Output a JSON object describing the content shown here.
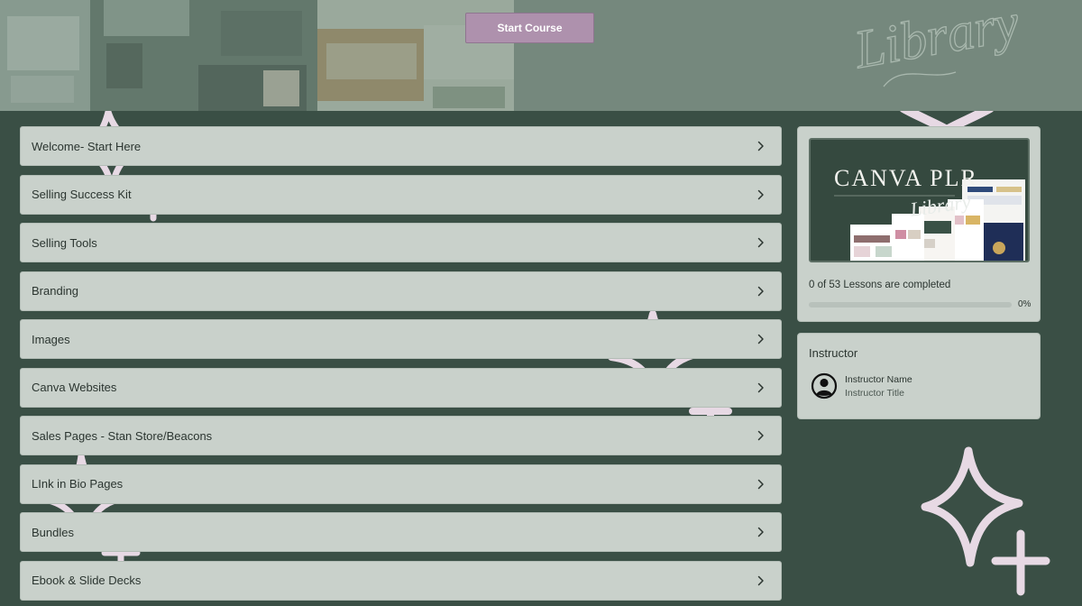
{
  "header": {
    "start_button_label": "Start Course",
    "script_text": "Library"
  },
  "lessons": [
    {
      "label": "Welcome- Start Here"
    },
    {
      "label": "Selling Success Kit"
    },
    {
      "label": "Selling Tools"
    },
    {
      "label": "Branding"
    },
    {
      "label": "Images"
    },
    {
      "label": "Canva Websites"
    },
    {
      "label": "Sales Pages - Stan Store/Beacons"
    },
    {
      "label": "LInk in Bio Pages"
    },
    {
      "label": "Bundles"
    },
    {
      "label": "Ebook & Slide Decks"
    }
  ],
  "course_card": {
    "thumbnail_title": "CANVA PLR",
    "thumbnail_script": "Library",
    "progress_text": "0 of 53 Lessons are completed",
    "progress_percent_label": "0%",
    "progress_fraction": 0
  },
  "instructor": {
    "heading": "Instructor",
    "name": "Instructor Name",
    "title": "Instructor Title"
  },
  "icons": {
    "chevron": "chevron-right-icon",
    "avatar": "user-circle-icon",
    "decor": "sparkle-icon"
  },
  "colors": {
    "background": "#3a4f45",
    "banner": "#75887d",
    "card": "#c9d1cb",
    "start_button": "#ae91ad",
    "sparkle": "#e7d9e4"
  }
}
